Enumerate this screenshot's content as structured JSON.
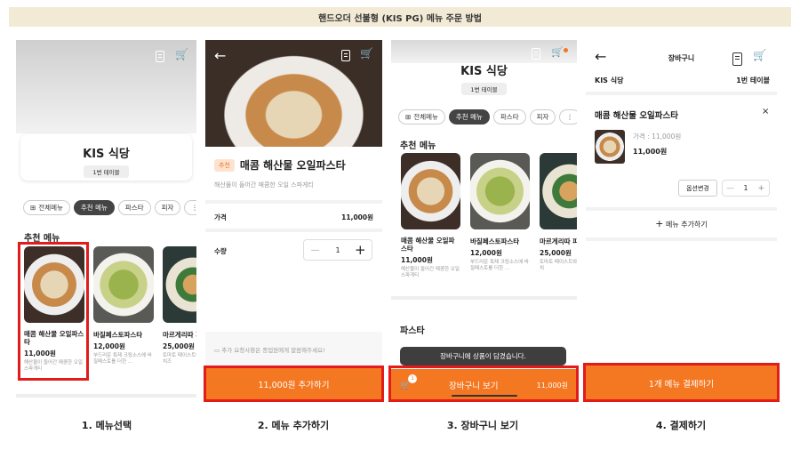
{
  "header_title": "핸드오더 선불형 (KIS PG) 메뉴 주문 방법",
  "accent": "#f47721",
  "highlight": "#e21b1b",
  "captions": [
    "1. 메뉴선택",
    "2. 메뉴 추가하기",
    "3. 장바구니 보기",
    "4. 결제하기"
  ],
  "restaurant": {
    "name": "KIS 식당",
    "table": "1번 테이블"
  },
  "categories": {
    "all": "전체메뉴",
    "recommend": "추천 메뉴",
    "pasta": "파스타",
    "pizza": "피자"
  },
  "section": {
    "recommended": "추천 메뉴",
    "pasta": "파스타"
  },
  "menus": [
    {
      "name": "매콤 해산물 오일파스타",
      "price": "11,000원",
      "desc": "해산물이 들어간 매콤한 오일 스파게티"
    },
    {
      "name": "바질페스토파스타",
      "price": "12,000원",
      "desc": "부드러운 특제 크림소스에 바질페스토를 더한 ..."
    },
    {
      "name": "마르게리따 피자",
      "price": "25,000원",
      "desc": "토마토 페이스트와 모짜렐라 치즈"
    }
  ],
  "panel3_menus": [
    {
      "name": "매콤 해산물 오일파스타",
      "price": "11,000원",
      "desc": "해산물이 들어간 매콤한 오일 스파게티"
    },
    {
      "name": "바질페스토파스타",
      "price": "12,000원",
      "desc": "부드러운 특제 크림소스에 바질페스토를 더한 ..."
    },
    {
      "name": "마르게리따 피",
      "price": "25,000원",
      "desc": "토마토 페이스트와 모짜렐라 치"
    }
  ],
  "detail": {
    "badge": "추천",
    "name": "매콤 해산물 오일파스타",
    "desc": "해산물이 들어간 매콤한 오일 스파게티",
    "price_label": "가격",
    "price": "11,000원",
    "qty_label": "수량",
    "qty": "1",
    "note": "추가 요청사항은 종업원에게 말씀해주세요!",
    "add_button": "11,000원 추가하기"
  },
  "toast": "장바구니에 상품이 담겼습니다.",
  "cart_bar": {
    "badge": "1",
    "label": "장바구니 보기",
    "price": "11,000원"
  },
  "cart": {
    "title": "장바구니",
    "restaurant": "KIS 식당",
    "table": "1번 테이블",
    "item_name": "매콤 해산물 오일파스타",
    "price_line": "가격 : 11,000원",
    "item_price": "11,000원",
    "option_button": "옵션변경",
    "qty": "1",
    "add_more": "메뉴 추가하기",
    "checkout": "1개 메뉴 결제하기"
  }
}
